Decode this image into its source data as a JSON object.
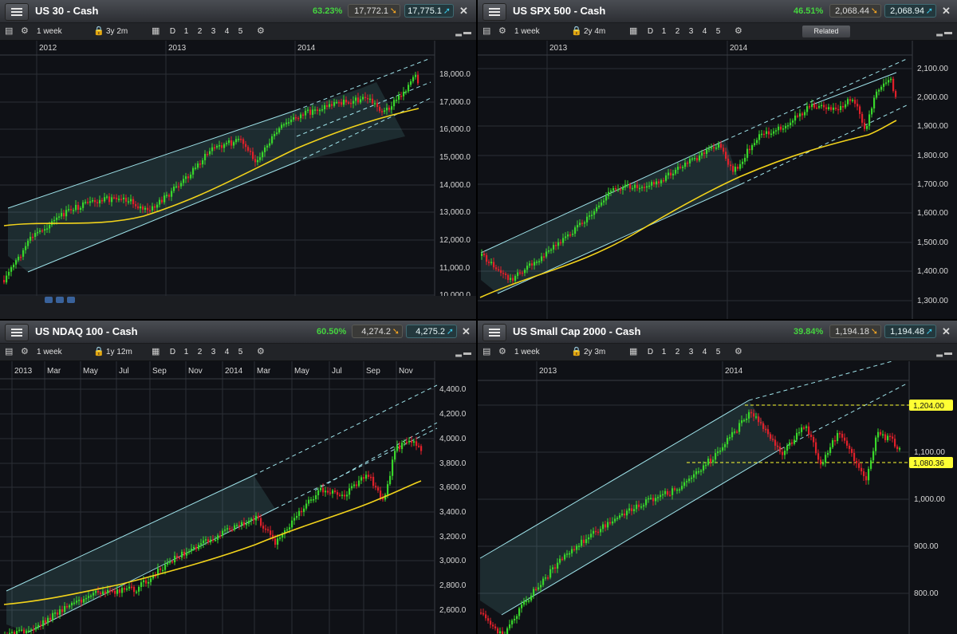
{
  "toolbar_labels": {
    "d": "D",
    "n1": "1",
    "n2": "2",
    "n3": "3",
    "n4": "4",
    "n5": "5",
    "related": "Related"
  },
  "panels": [
    {
      "title": "US 30 - Cash",
      "change_pct": "63.23%",
      "sell": "17,772.1",
      "buy": "17,775.1",
      "interval": "1 week",
      "range": "3y 2m",
      "time_labels": [
        "2012",
        "2013",
        "2014"
      ],
      "price_labels": [
        "18,000.0",
        "17,000.0",
        "16,000.0",
        "15,000.0",
        "14,000.0",
        "13,000.0",
        "12,000.0",
        "11,000.0",
        "10,000.0"
      ]
    },
    {
      "title": "US SPX 500 - Cash",
      "change_pct": "46.51%",
      "sell": "2,068.44",
      "buy": "2,068.94",
      "interval": "1 week",
      "range": "2y 4m",
      "time_labels": [
        "2013",
        "2014"
      ],
      "price_labels": [
        "2,100.00",
        "2,000.00",
        "1,900.00",
        "1,800.00",
        "1,700.00",
        "1,600.00",
        "1,500.00",
        "1,400.00",
        "1,300.00"
      ]
    },
    {
      "title": "US NDAQ 100 - Cash",
      "change_pct": "60.50%",
      "sell": "4,274.2",
      "buy": "4,275.2",
      "interval": "1 week",
      "range": "1y 12m",
      "time_labels": [
        "2013",
        "Mar",
        "May",
        "Jul",
        "Sep",
        "Nov",
        "2014",
        "Mar",
        "May",
        "Jul",
        "Sep",
        "Nov"
      ],
      "price_labels": [
        "4,400.0",
        "4,200.0",
        "4,000.0",
        "3,800.0",
        "3,600.0",
        "3,400.0",
        "3,200.0",
        "3,000.0",
        "2,800.0",
        "2,600.0"
      ]
    },
    {
      "title": "US Small Cap 2000 - Cash",
      "change_pct": "39.84%",
      "sell": "1,194.18",
      "buy": "1,194.48",
      "interval": "1 week",
      "range": "2y 3m",
      "time_labels": [
        "2013",
        "2014"
      ],
      "price_labels": [
        "1,100.00",
        "1,000.00",
        "900.00",
        "800.00"
      ],
      "level_labels": [
        "1,204.00",
        "1,080.36"
      ]
    }
  ],
  "colors": {
    "bull": "#39d62b",
    "bear": "#e0202a",
    "moving_average": "#f2d31b",
    "channel": "#9fe3ea",
    "level_highlight": "#ffff33"
  }
}
